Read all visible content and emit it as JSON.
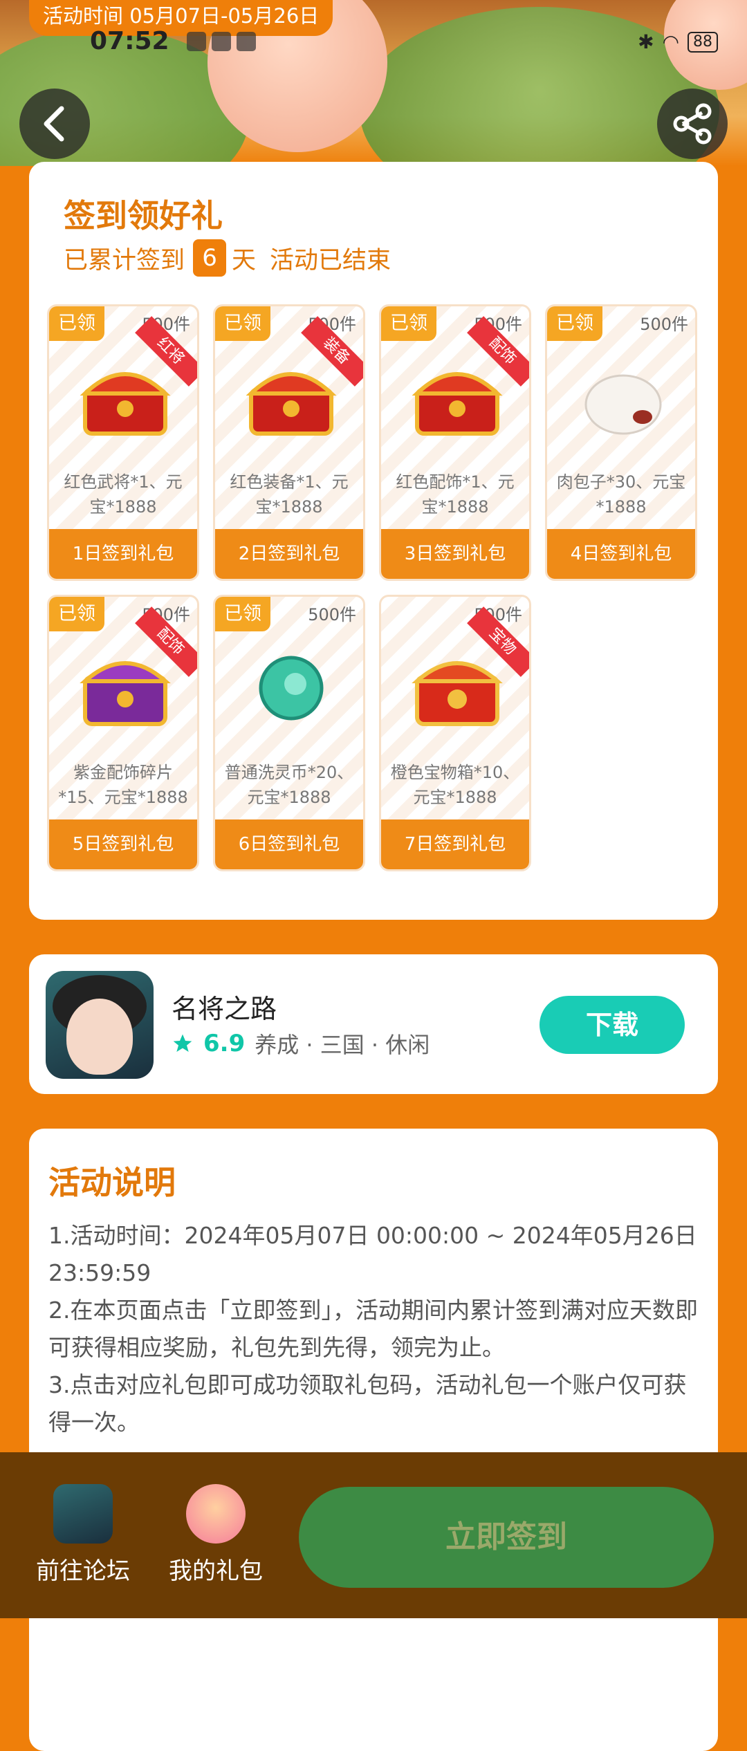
{
  "header": {
    "activity_time": "活动时间 05月07日-05月26日",
    "status_time": "07:52",
    "battery": "88"
  },
  "signin": {
    "title": "签到领好礼",
    "sub_prefix": "已累计签到",
    "days": "6",
    "sub_suffix": "天",
    "status": "活动已结束",
    "gifts": [
      {
        "got": "已领",
        "stock": "500件",
        "tag": "红将",
        "desc": "红色武将*1、元宝*1888",
        "label": "1日签到礼包"
      },
      {
        "got": "已领",
        "stock": "500件",
        "tag": "装备",
        "desc": "红色装备*1、元宝*1888",
        "label": "2日签到礼包"
      },
      {
        "got": "已领",
        "stock": "500件",
        "tag": "配饰",
        "desc": "红色配饰*1、元宝*1888",
        "label": "3日签到礼包"
      },
      {
        "got": "已领",
        "stock": "500件",
        "tag": "",
        "desc": "肉包子*30、元宝*1888",
        "label": "4日签到礼包"
      },
      {
        "got": "已领",
        "stock": "500件",
        "tag": "配饰",
        "desc": "紫金配饰碎片*15、元宝*1888",
        "label": "5日签到礼包"
      },
      {
        "got": "已领",
        "stock": "500件",
        "tag": "",
        "desc": "普通洗灵币*20、元宝*1888",
        "label": "6日签到礼包"
      },
      {
        "got": "",
        "stock": "500件",
        "tag": "宝物",
        "desc": "橙色宝物箱*10、元宝*1888",
        "label": "7日签到礼包"
      }
    ]
  },
  "game": {
    "name": "名将之路",
    "score": "6.9",
    "tags": "养成 · 三国 · 休闲",
    "download": "下载"
  },
  "description": {
    "title": "活动说明",
    "lines": [
      "1.活动时间：2024年05月07日 00:00:00 ~ 2024年05月26日 23:59:59",
      "2.在本页面点击「立即签到」，活动期间内累计签到满对应天数即可获得相应奖励，礼包先到先得，领完为止。",
      "3.点击对应礼包即可成功领取礼包码，活动礼包一个账户仅可获得一次。"
    ]
  },
  "bottom": {
    "forum": "前往论坛",
    "my_gifts": "我的礼包",
    "signin": "立即签到"
  },
  "colors": {
    "accent": "#ef7f0a",
    "teal": "#19ccb5",
    "bottom_bar": "#6b3c04",
    "signin_button": "#3d8b44"
  }
}
